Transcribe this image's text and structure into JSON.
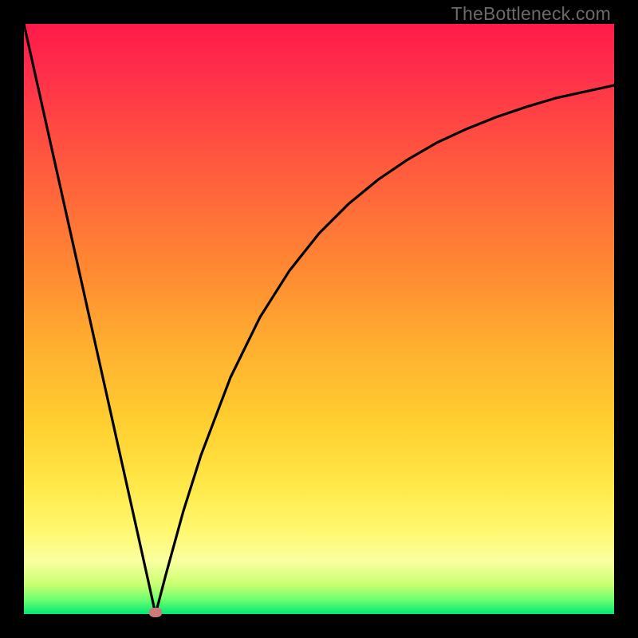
{
  "watermark": "TheBottleneck.com",
  "chart_data": {
    "type": "line",
    "title": "",
    "xlabel": "",
    "ylabel": "",
    "xlim": [
      0,
      1
    ],
    "ylim": [
      0,
      1
    ],
    "series": [
      {
        "name": "curve",
        "x": [
          0.0,
          0.05,
          0.1,
          0.15,
          0.19,
          0.21,
          0.223,
          0.24,
          0.27,
          0.3,
          0.35,
          0.4,
          0.45,
          0.5,
          0.55,
          0.6,
          0.65,
          0.7,
          0.75,
          0.8,
          0.85,
          0.9,
          0.95,
          1.0
        ],
        "y": [
          1.0,
          0.776,
          0.552,
          0.328,
          0.149,
          0.059,
          0.0,
          0.065,
          0.174,
          0.269,
          0.401,
          0.503,
          0.582,
          0.645,
          0.695,
          0.736,
          0.77,
          0.799,
          0.822,
          0.842,
          0.859,
          0.874,
          0.885,
          0.896
        ]
      }
    ],
    "marker": {
      "x": 0.223,
      "y": 0.003,
      "color": "#cc7a7a"
    },
    "background_gradient": {
      "stops": [
        {
          "pos": 0.0,
          "color": "#ff1a4a"
        },
        {
          "pos": 0.55,
          "color": "#ffb030"
        },
        {
          "pos": 0.86,
          "color": "#fff870"
        },
        {
          "pos": 1.0,
          "color": "#00e874"
        }
      ]
    }
  }
}
